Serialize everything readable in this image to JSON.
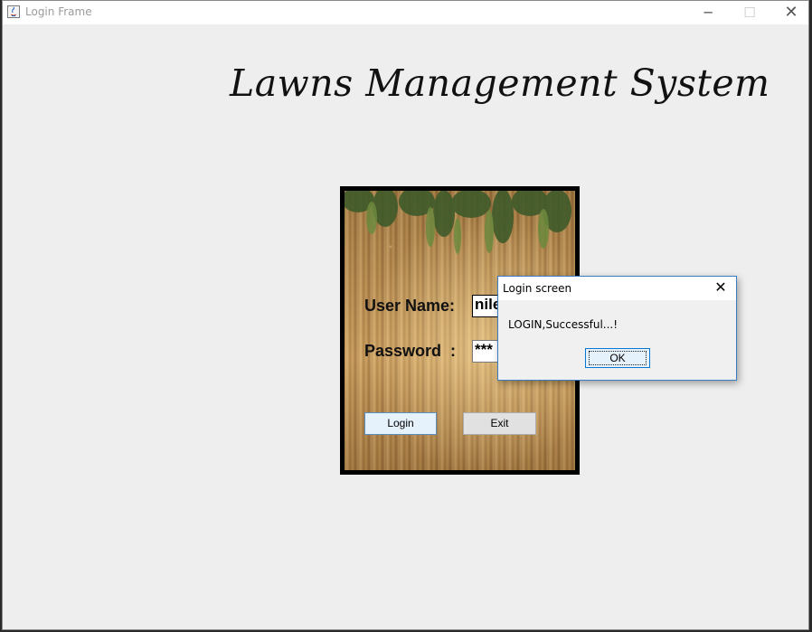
{
  "window": {
    "title": "Login Frame",
    "controls": {
      "minimize": "─",
      "maximize": "☐",
      "close": "✕"
    }
  },
  "main": {
    "heading": "Lawns Management System"
  },
  "login_form": {
    "username_label": "User Name:",
    "username_value": "nile",
    "password_label": "Password  :",
    "password_value": "***",
    "login_button": "Login",
    "exit_button": "Exit"
  },
  "dialog": {
    "title": "Login screen",
    "close": "✕",
    "message": "LOGIN,Successful...!",
    "ok_button": "OK"
  },
  "colors": {
    "window_bg": "#eeeeee",
    "accent": "#0078d7",
    "panel_border": "#000000"
  },
  "icons": [
    "java-app-icon",
    "minimize-icon",
    "maximize-icon",
    "close-icon"
  ]
}
